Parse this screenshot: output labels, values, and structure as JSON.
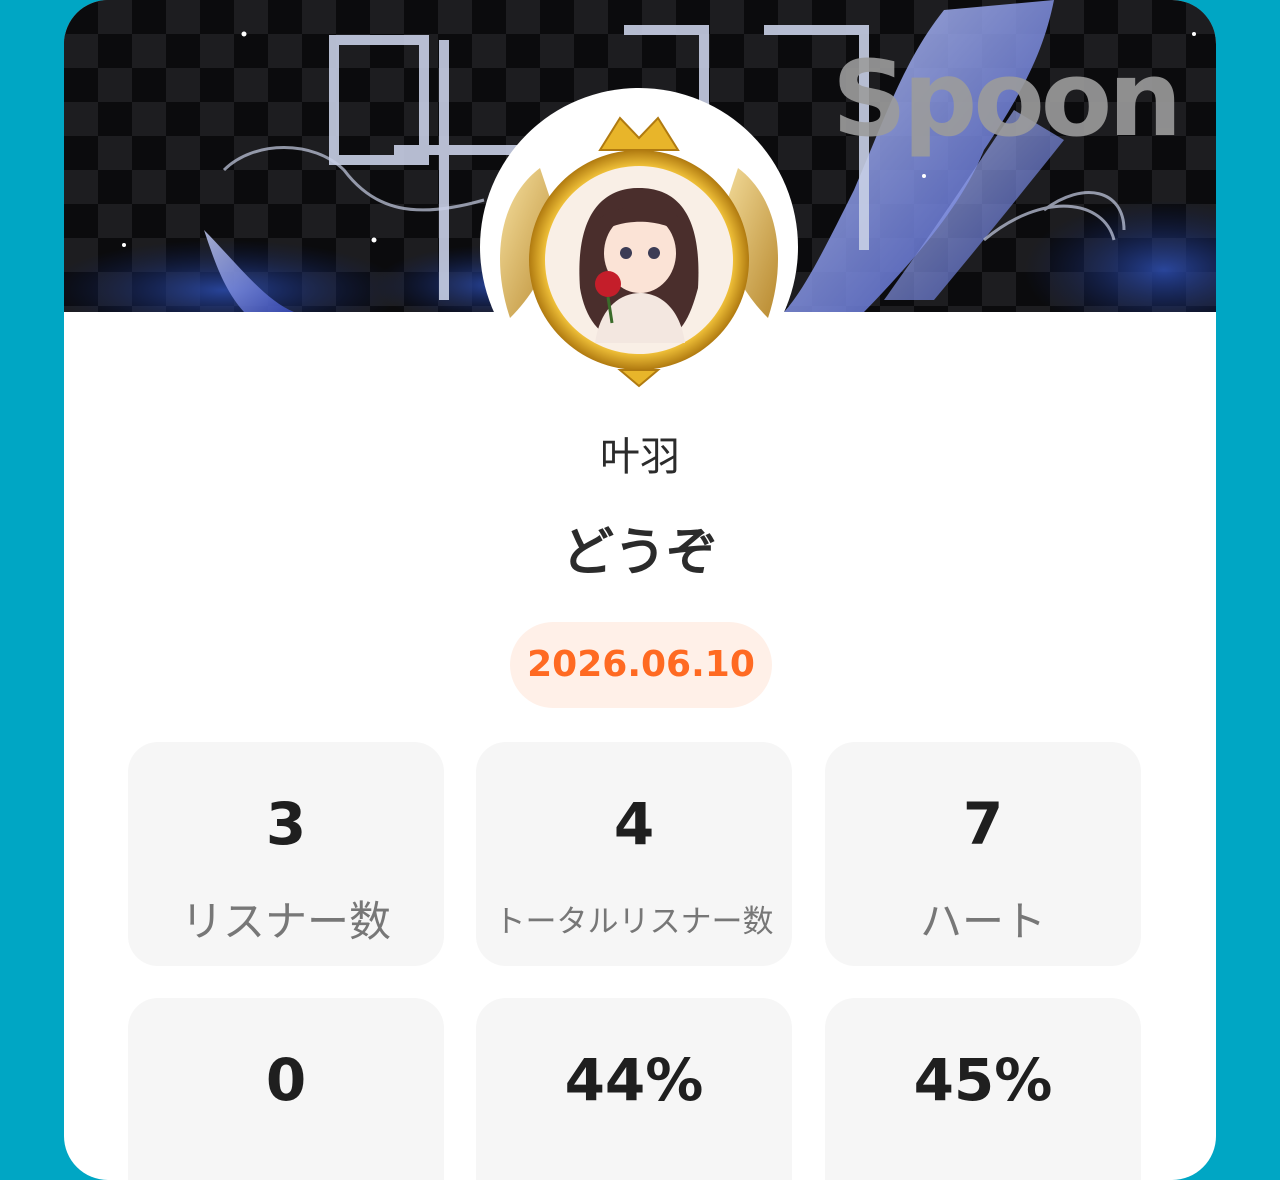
{
  "banner": {
    "brand": "Spoon",
    "kanji_art": "叶羽"
  },
  "profile": {
    "name": "叶羽",
    "title": "どうぞ",
    "date": "2026.06.10"
  },
  "stats": [
    {
      "value": "3",
      "label": "リスナー数"
    },
    {
      "value": "4",
      "label": "トータルリスナー数"
    },
    {
      "value": "7",
      "label": "ハート"
    },
    {
      "value": "0",
      "label": ""
    },
    {
      "value": "44%",
      "label": ""
    },
    {
      "value": "45%",
      "label": ""
    }
  ],
  "colors": {
    "background": "#00a6c4",
    "card": "#ffffff",
    "date_text": "#ff6a22",
    "date_bg": "#fff0e8",
    "stat_bg": "#f6f6f6"
  }
}
